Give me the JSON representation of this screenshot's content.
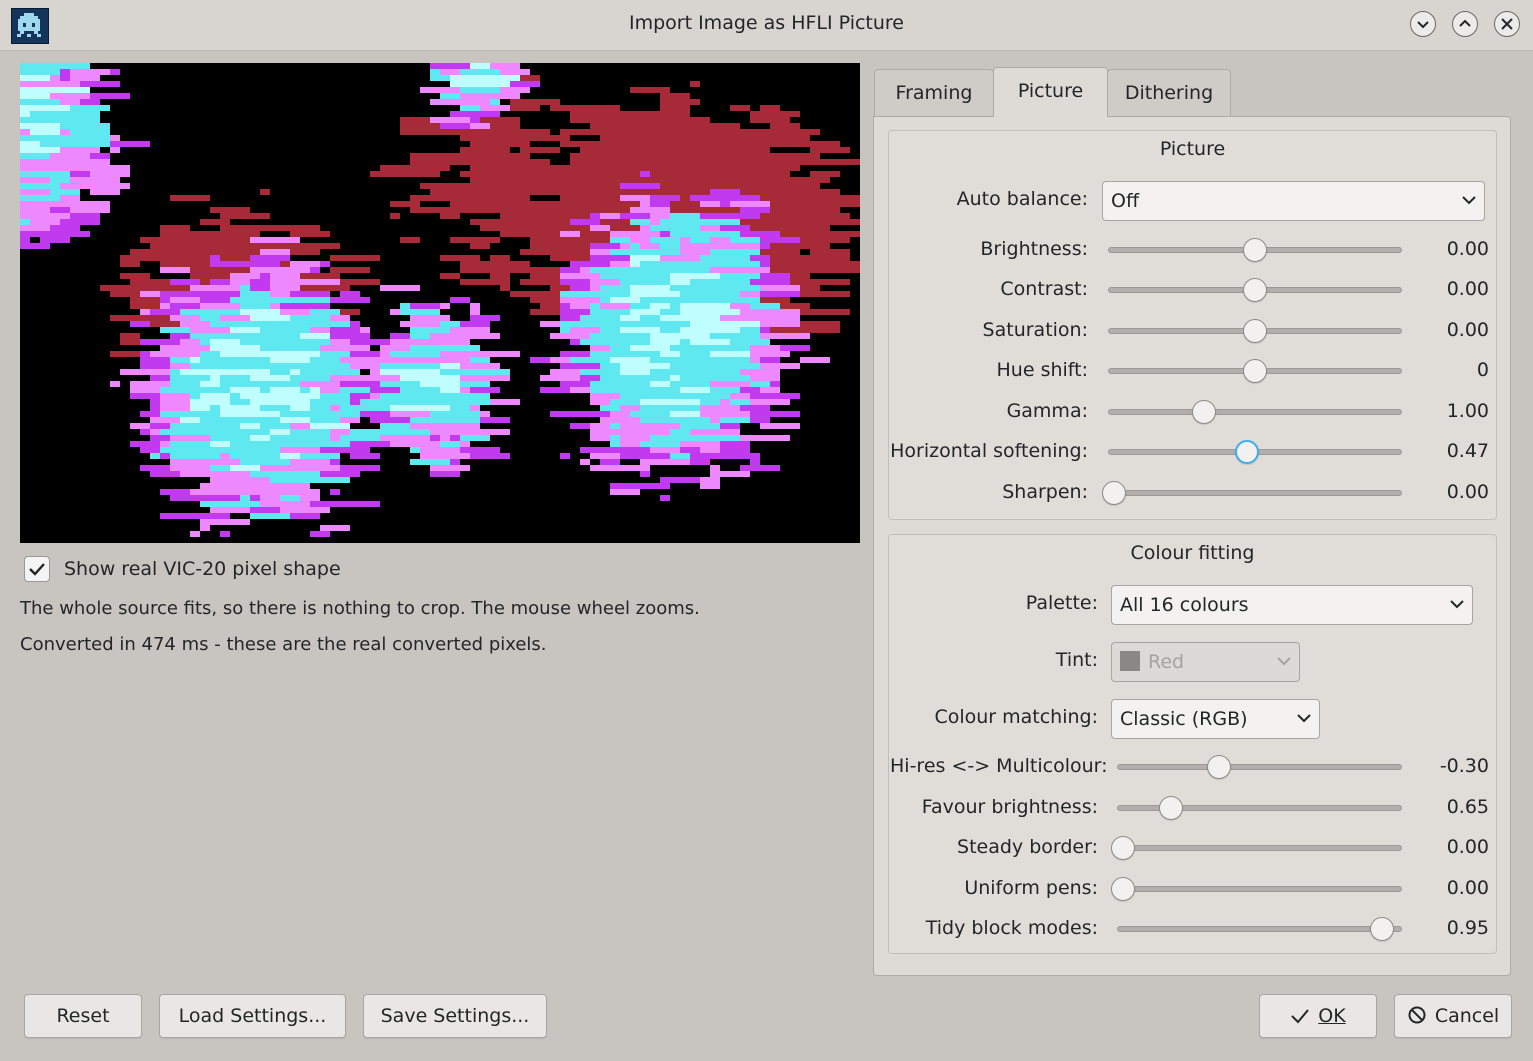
{
  "window": {
    "title": "Import Image as HFLI Picture",
    "app_icon": "space-invader-icon",
    "controls": [
      "minimize-icon",
      "maximize-icon",
      "close-icon"
    ]
  },
  "preview": {
    "show_pixel_shape_label": "Show real VIC-20 pixel shape",
    "show_pixel_shape_checked": true,
    "crop_info": "The whole source fits, so there is nothing to crop. The mouse wheel zooms.",
    "convert_info": "Converted in 474 ms - these are the real converted pixels."
  },
  "tabs": [
    {
      "label": "Framing",
      "active": false
    },
    {
      "label": "Picture",
      "active": true
    },
    {
      "label": "Dithering",
      "active": false
    }
  ],
  "picture_group": {
    "title": "Picture",
    "auto_balance": {
      "label": "Auto balance:",
      "value": "Off"
    },
    "sliders": [
      {
        "label": "Brightness:",
        "value": "0.00",
        "fraction": 0.5
      },
      {
        "label": "Contrast:",
        "value": "0.00",
        "fraction": 0.5
      },
      {
        "label": "Saturation:",
        "value": "0.00",
        "fraction": 0.5
      },
      {
        "label": "Hue shift:",
        "value": "0",
        "fraction": 0.5
      },
      {
        "label": "Gamma:",
        "value": "1.00",
        "fraction": 0.32
      },
      {
        "label": "Horizontal softening:",
        "value": "0.47",
        "fraction": 0.47
      },
      {
        "label": "Sharpen:",
        "value": "0.00",
        "fraction": 0.0
      }
    ]
  },
  "colour_group": {
    "title": "Colour fitting",
    "palette": {
      "label": "Palette:",
      "value": "All 16 colours"
    },
    "tint": {
      "label": "Tint:",
      "value": "Red",
      "disabled": true
    },
    "matching": {
      "label": "Colour matching:",
      "value": "Classic (RGB)"
    },
    "sliders": [
      {
        "label": "Hi-res <-> Multicolour:",
        "value": "-0.30",
        "fraction": 0.35
      },
      {
        "label": "Favour brightness:",
        "value": "0.65",
        "fraction": 0.175
      },
      {
        "label": "Steady border:",
        "value": "0.00",
        "fraction": 0.0
      },
      {
        "label": "Uniform pens:",
        "value": "0.00",
        "fraction": 0.0
      },
      {
        "label": "Tidy block modes:",
        "value": "0.95",
        "fraction": 0.95
      }
    ]
  },
  "buttons": {
    "reset": "Reset",
    "load": "Load Settings...",
    "save": "Save Settings...",
    "ok": "OK",
    "cancel": "Cancel"
  },
  "colors": {
    "accent": "#3daee9",
    "window_bg": "#c8c4c0",
    "panel_bg": "#dedad6",
    "preview_palette": [
      "#000000",
      "#a62a38",
      "#c23af0",
      "#ee88ff",
      "#60e8f0",
      "#c0ffff"
    ]
  }
}
